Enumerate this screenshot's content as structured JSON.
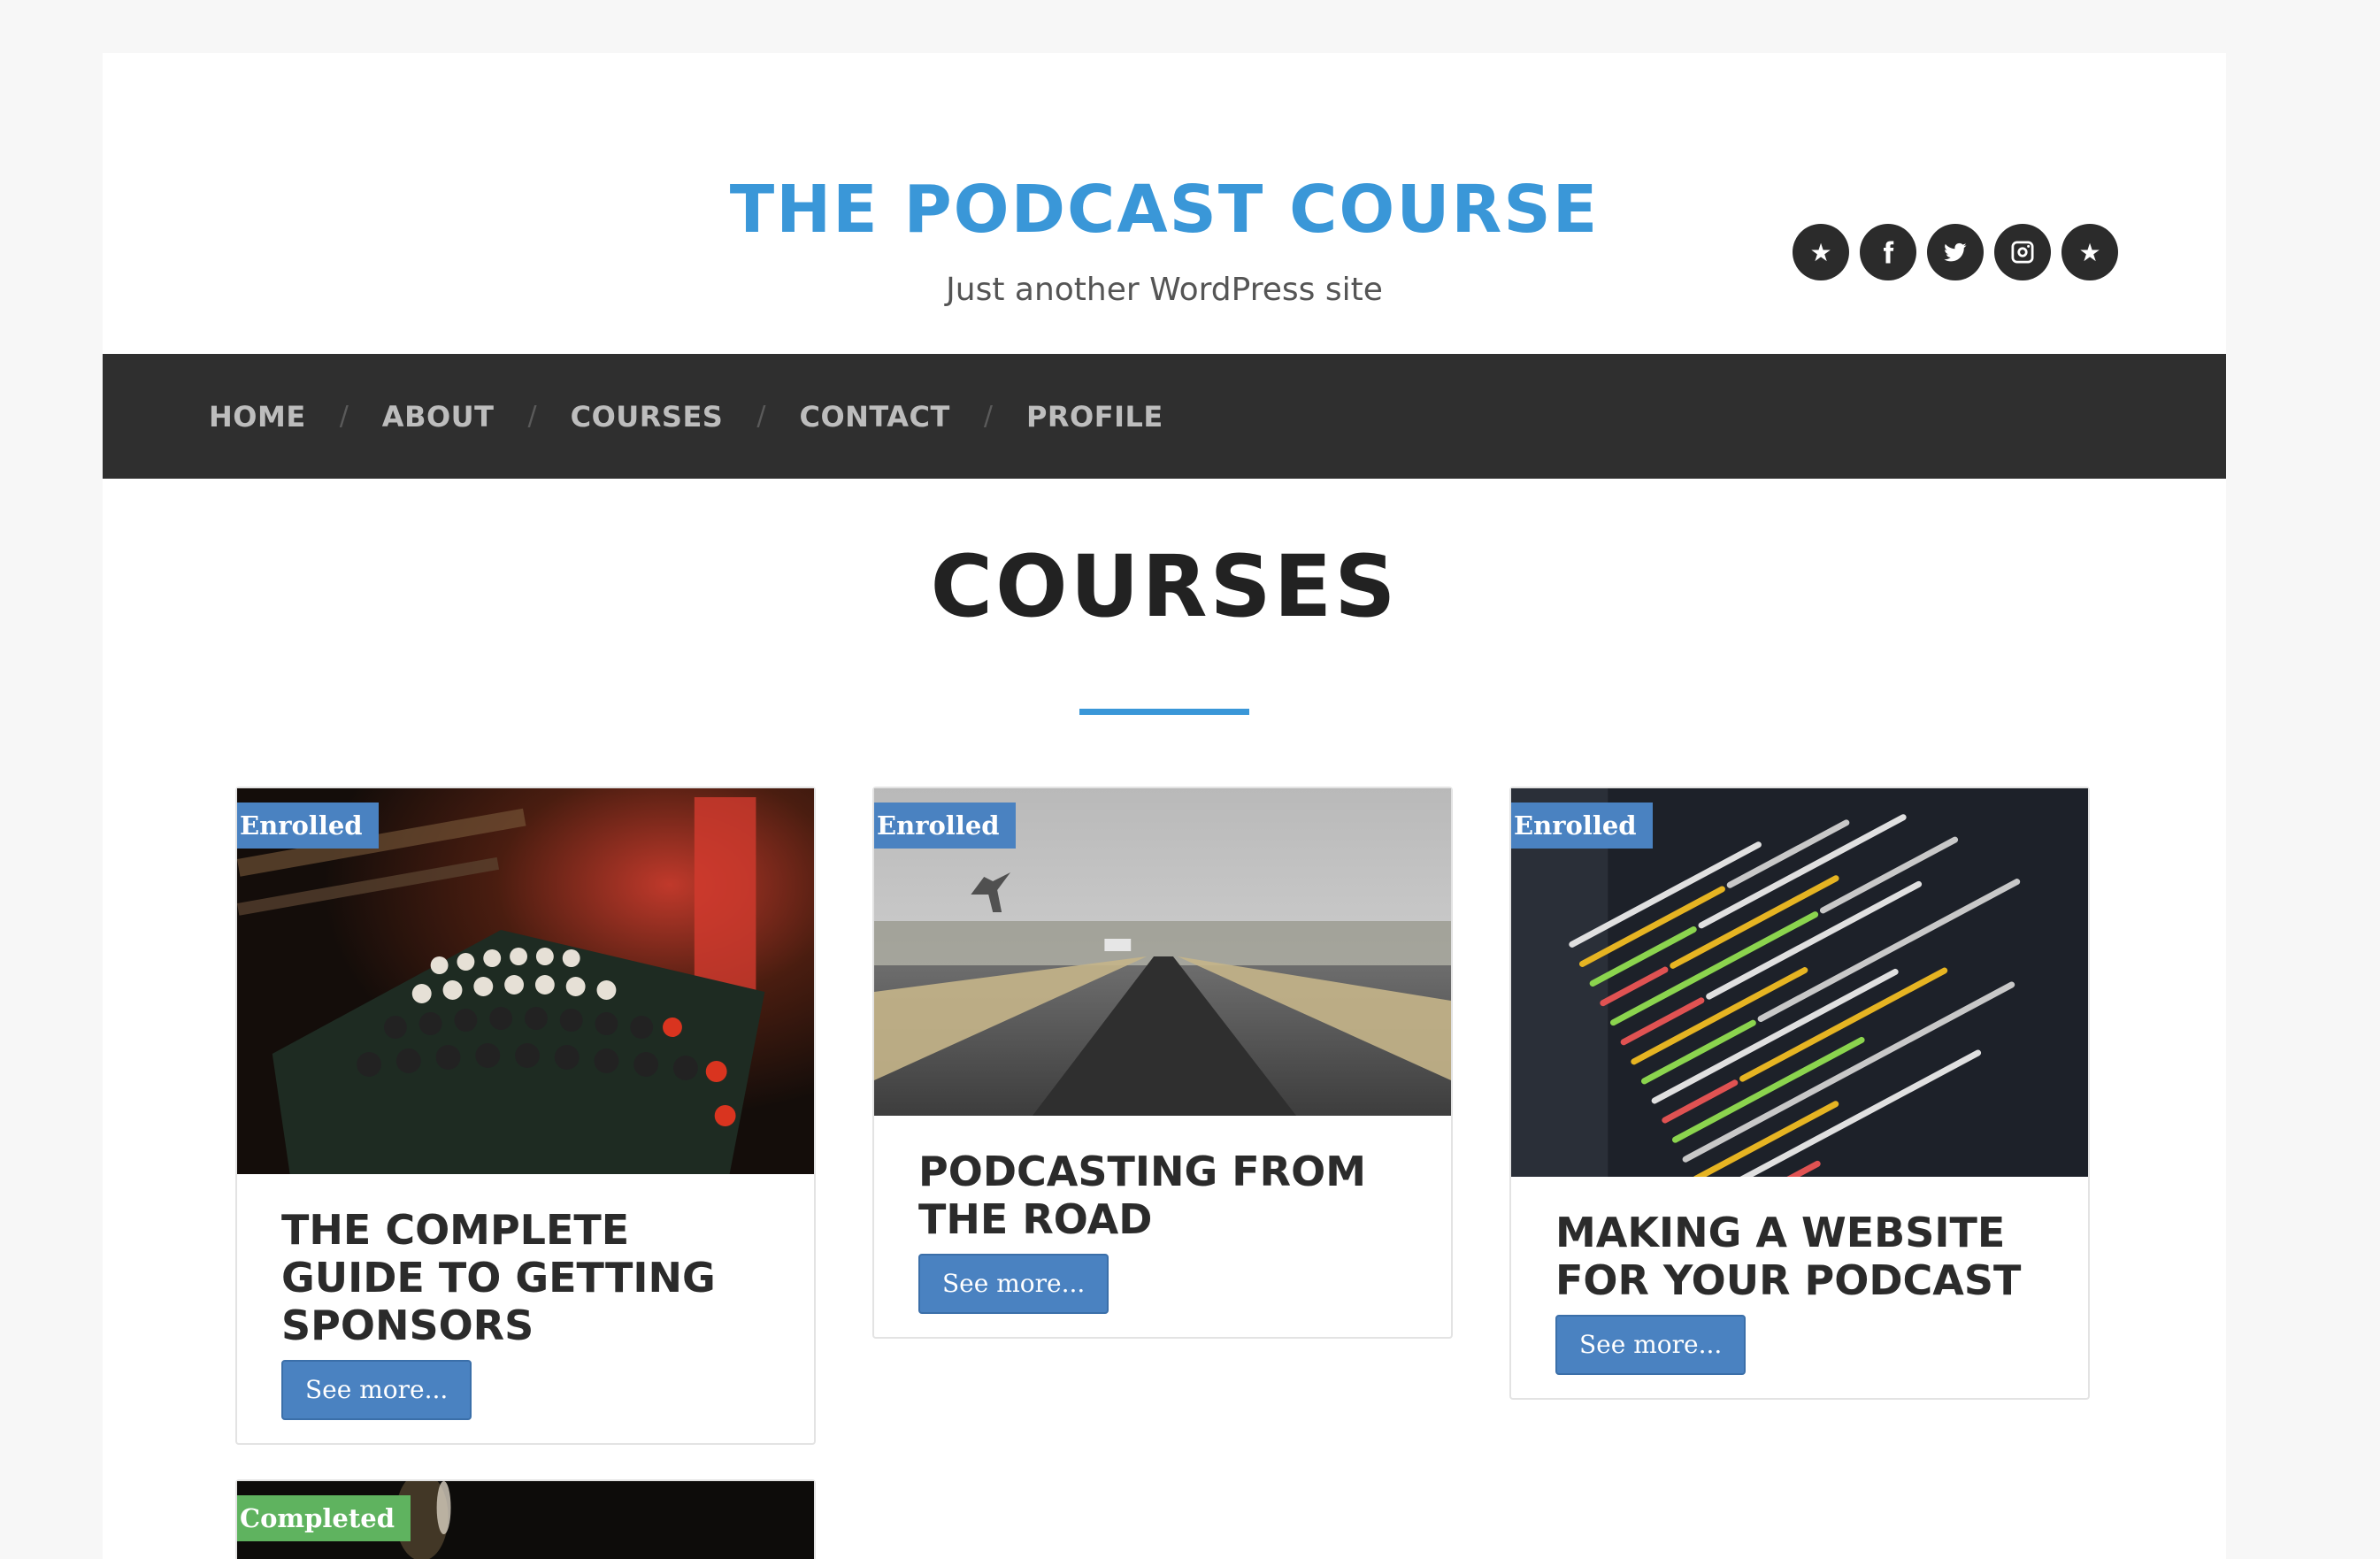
{
  "site": {
    "title": "THE PODCAST COURSE",
    "description": "Just another WordPress site"
  },
  "social": [
    "star-icon",
    "facebook-icon",
    "twitter-icon",
    "instagram-icon",
    "star-icon"
  ],
  "nav": {
    "items": [
      {
        "label": "HOME"
      },
      {
        "label": "ABOUT"
      },
      {
        "label": "COURSES"
      },
      {
        "label": "CONTACT"
      },
      {
        "label": "PROFILE"
      }
    ],
    "separator": "/"
  },
  "page": {
    "title": "COURSES"
  },
  "colors": {
    "accent": "#3a97d8",
    "nav_bg": "#2f2f2f",
    "enrolled": "#4a82c1",
    "completed": "#5fb35f"
  },
  "courses": [
    {
      "badge": "Enrolled",
      "title": "THE COMPLETE GUIDE TO GETTING SPONSORS",
      "button": "See more..."
    },
    {
      "badge": "Enrolled",
      "title": "PODCASTING FROM THE ROAD",
      "button": "See more..."
    },
    {
      "badge": "Enrolled",
      "title": "MAKING A WEBSITE FOR YOUR PODCAST",
      "button": "See more..."
    },
    {
      "badge": "Completed",
      "title": "",
      "button": ""
    }
  ]
}
